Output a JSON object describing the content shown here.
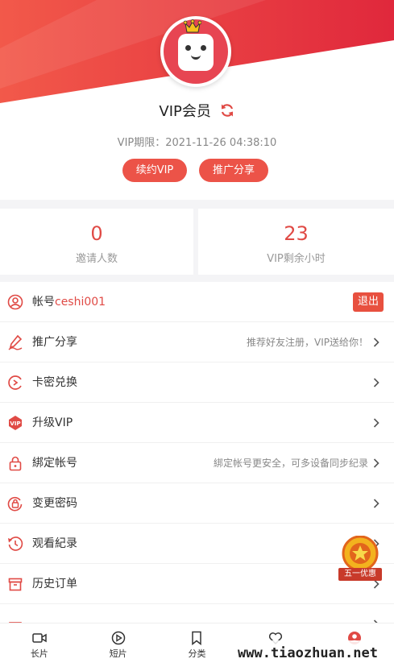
{
  "header": {
    "title": "VIP会员",
    "expire_text": "VIP期限：2021-11-26 04:38:10",
    "renew_button": "续约VIP",
    "share_button": "推广分享",
    "colors": {
      "accent": "#e04a45",
      "gradient_start": "#f2594a",
      "gradient_end": "#e0283c"
    }
  },
  "stats": [
    {
      "value": "0",
      "label": "邀请人数"
    },
    {
      "value": "23",
      "label": "VIP剩余小时"
    }
  ],
  "account": {
    "prefix": "帐号",
    "username": "ceshi001",
    "logout_label": "退出"
  },
  "menu": [
    {
      "label": "推广分享",
      "hint": "推荐好友注册，VIP送给你！",
      "icon": "pen-icon"
    },
    {
      "label": "卡密兑换",
      "hint": "",
      "icon": "card-icon"
    },
    {
      "label": "升级VIP",
      "hint": "",
      "icon": "vip-icon"
    },
    {
      "label": "綁定帐号",
      "hint": "綁定帐号更安全，可多设备同步纪录",
      "icon": "lock-icon"
    },
    {
      "label": "变更密码",
      "hint": "",
      "icon": "key-lock-icon"
    },
    {
      "label": "观看紀录",
      "hint": "",
      "icon": "history-icon"
    },
    {
      "label": "历史订单",
      "hint": "",
      "icon": "box-icon"
    }
  ],
  "promo_badge": {
    "text": "五一优惠"
  },
  "tabbar": [
    {
      "label": "长片",
      "icon": "video-icon"
    },
    {
      "label": "短片",
      "icon": "play-circle-icon"
    },
    {
      "label": "分类",
      "icon": "bookmark-icon"
    },
    {
      "label": "",
      "icon": "heart-icon"
    },
    {
      "label": "",
      "icon": "user-icon"
    }
  ],
  "watermark": "www.tiaozhuan.net"
}
